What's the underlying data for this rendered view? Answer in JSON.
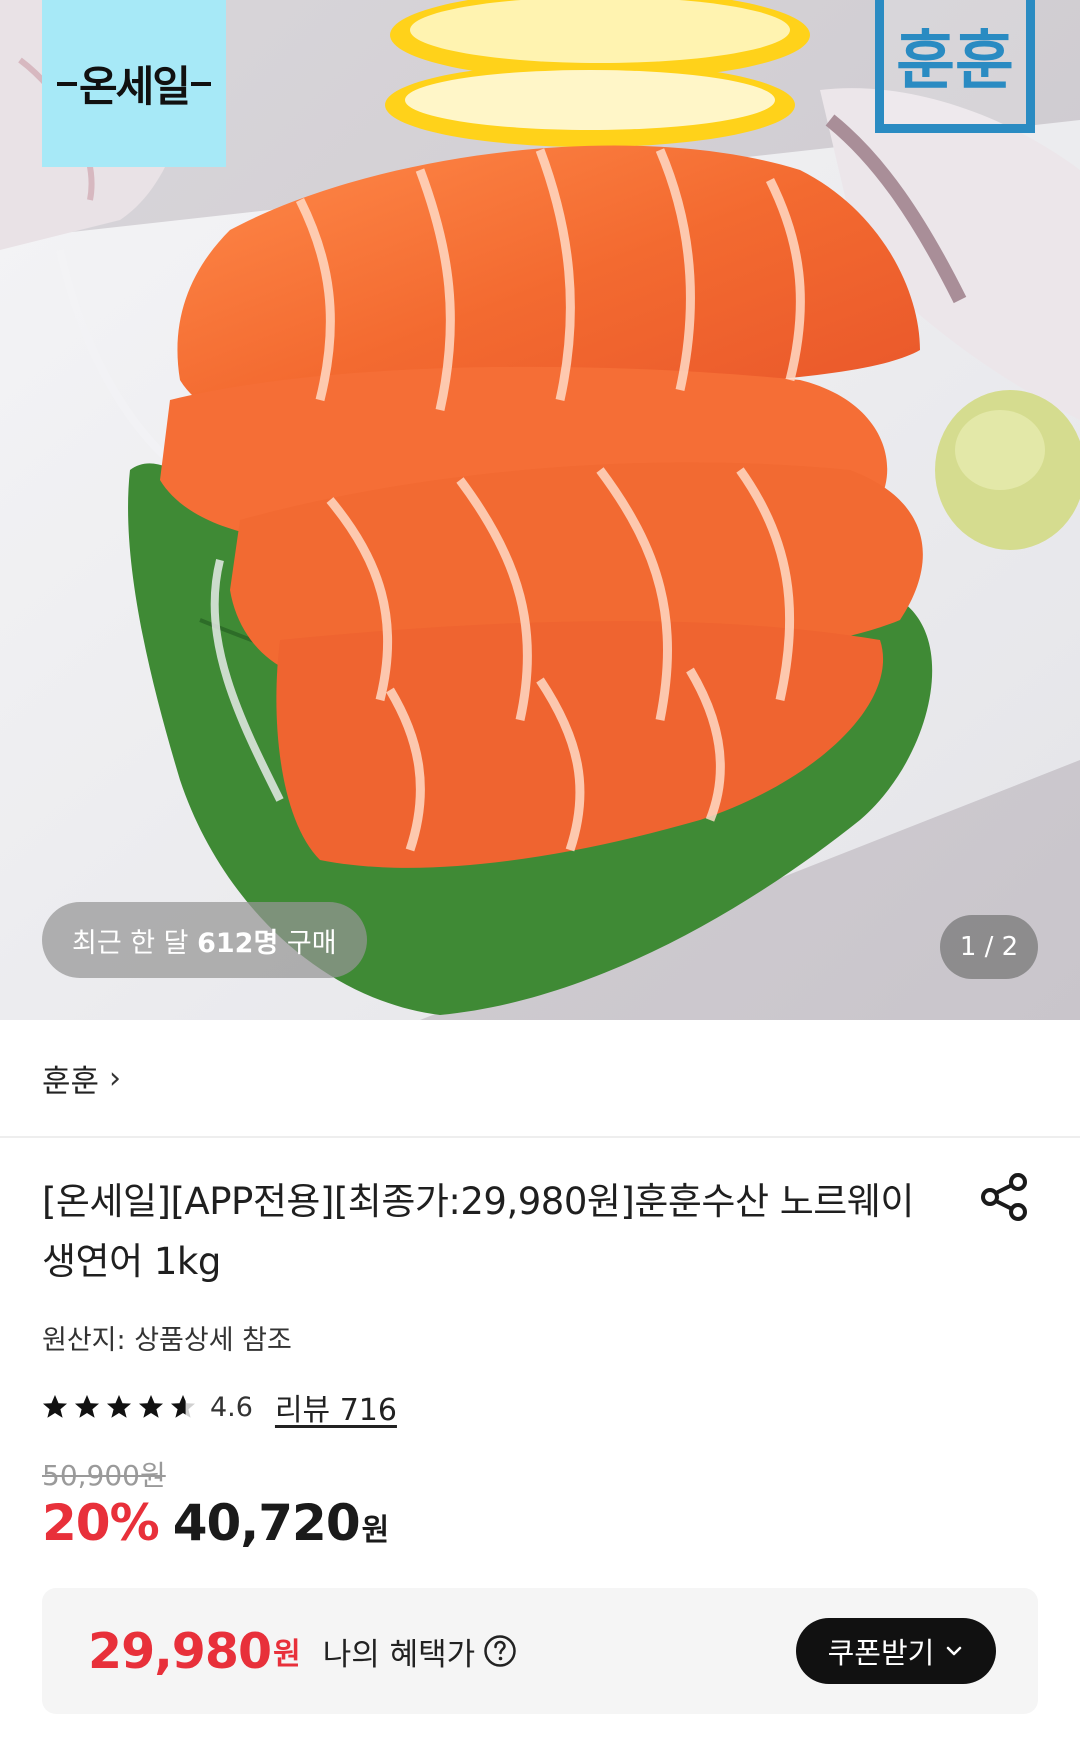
{
  "hero": {
    "badge_text": "온세일",
    "brand_logo_text": "훈훈",
    "purchase_prefix": "최근 한 달 ",
    "purchase_count": "612명",
    "purchase_suffix": " 구매",
    "page_indicator": "1 / 2"
  },
  "store": {
    "name": "훈훈",
    "chevron": "›"
  },
  "product": {
    "title": "[온세일][APP전용][최종가:29,980원]훈훈수산 노르웨이 생연어 1kg",
    "origin": "원산지: 상품상세 참조",
    "rating": "4.6",
    "rating_stars": 4.6,
    "review_link": "리뷰 716",
    "original_price": "50,900원",
    "discount": "20%",
    "sale_price": "40,720",
    "currency": "원"
  },
  "benefit": {
    "price": "29,980",
    "currency": "원",
    "label": "나의 혜택가",
    "coupon_button": "쿠폰받기"
  },
  "icons": {
    "share": "share-icon",
    "help": "question-circle-icon",
    "coupon_chevron": "chevron-down-icon",
    "star": "star-icon"
  },
  "colors": {
    "accent_red": "#e8303a",
    "badge_cyan": "#a7e9f7",
    "brand_blue": "#2a8bc2",
    "button_black": "#111111"
  }
}
